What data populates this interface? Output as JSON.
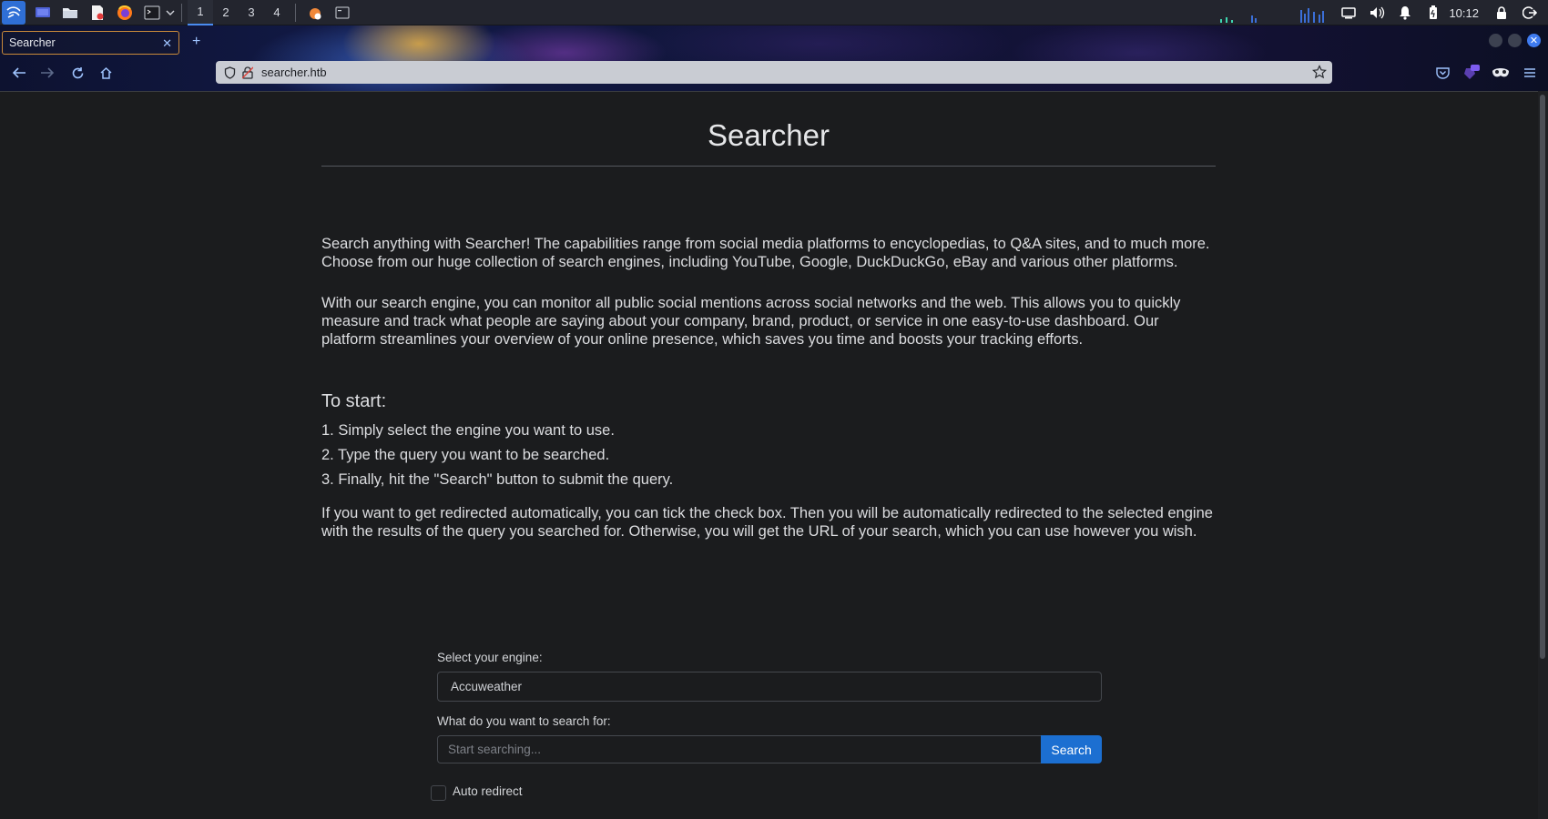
{
  "taskbar": {
    "workspaces": [
      "1",
      "2",
      "3",
      "4"
    ],
    "active_workspace": "1",
    "clock": "10:12",
    "apps": [
      "kali-menu-icon",
      "desktop-icon",
      "file-manager-icon",
      "text-editor-icon",
      "firefox-icon",
      "terminal-icon"
    ]
  },
  "browser": {
    "tab_title": "Searcher",
    "url": "searcher.htb"
  },
  "page": {
    "title": "Searcher",
    "intro_1": "Search anything with Searcher! The capabilities range from social media platforms to encyclopedias, to Q&A sites, and to much more. Choose from our huge collection of search engines, including YouTube, Google, DuckDuckGo, eBay and various other platforms.",
    "intro_2": "With our search engine, you can monitor all public social mentions across social networks and the web. This allows you to quickly measure and track what people are saying about your company, brand, product, or service in one easy-to-use dashboard. Our platform streamlines your overview of your online presence, which saves you time and boosts your tracking efforts.",
    "start_heading": "To start:",
    "steps": [
      "1. Simply select the engine you want to use.",
      "2. Type the query you want to be searched.",
      "3. Finally, hit the \"Search\" button to submit the query."
    ],
    "redirect_info": "If you want to get redirected automatically, you can tick the check box. Then you will be automatically redirected to the selected engine with the results of the query you searched for. Otherwise, you will get the URL of your search, which you can use however you wish."
  },
  "form": {
    "engine_label": "Select your engine:",
    "engine_value": "Accuweather",
    "query_label": "What do you want to search for:",
    "query_placeholder": "Start searching...",
    "search_button": "Search",
    "auto_redirect_label": "Auto redirect",
    "auto_redirect_checked": false
  },
  "colors": {
    "page_bg": "#1b1c1e",
    "accent": "#1c6fd1",
    "text": "#dcdde0"
  }
}
